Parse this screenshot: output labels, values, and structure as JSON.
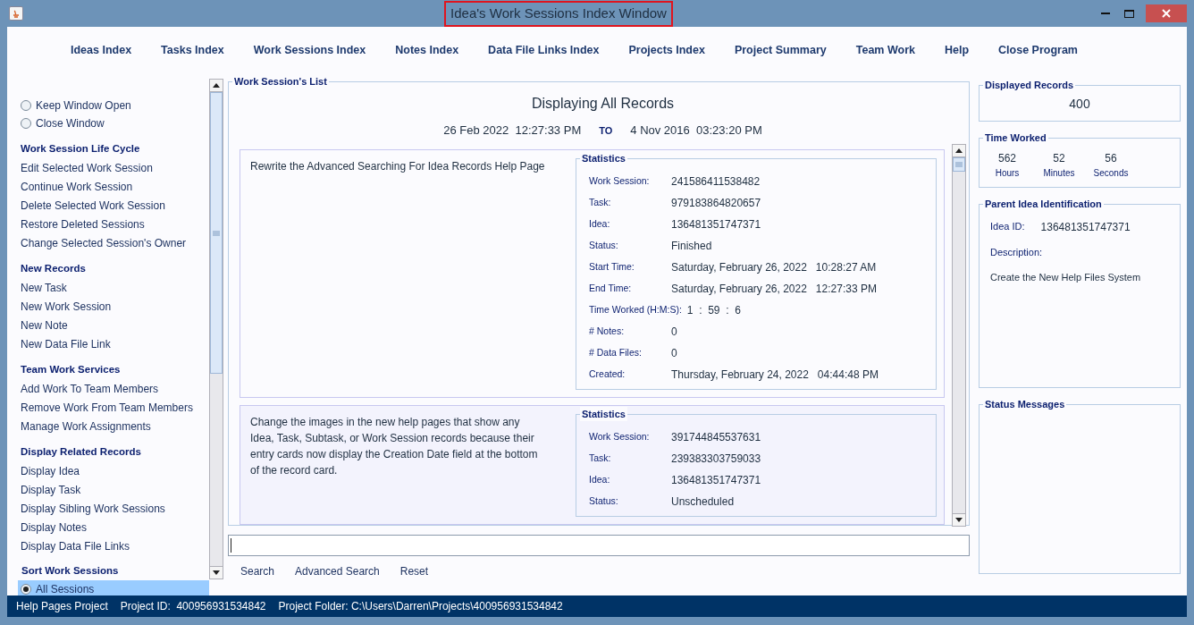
{
  "window": {
    "title": "Idea's Work Sessions Index Window",
    "title_highlighted": true
  },
  "menu": [
    "Ideas Index",
    "Tasks Index",
    "Work Sessions Index",
    "Notes Index",
    "Data File Links Index",
    "Projects Index",
    "Project Summary",
    "Team Work",
    "Help",
    "Close Program"
  ],
  "sidebar": {
    "options": [
      {
        "label": "Keep Window Open",
        "selected": false
      },
      {
        "label": "Close Window",
        "selected": false
      }
    ],
    "sections": [
      {
        "title": "Work Session Life Cycle",
        "items": [
          "Edit Selected Work Session",
          "Continue Work Session",
          "Delete Selected Work Session",
          "Restore Deleted Sessions",
          "Change Selected Session's Owner"
        ]
      },
      {
        "title": "New Records",
        "items": [
          "New Task",
          "New Work Session",
          "New Note",
          "New Data File Link"
        ]
      },
      {
        "title": "Team Work Services",
        "items": [
          "Add Work To Team Members",
          "Remove Work From Team Members",
          "Manage Work Assignments"
        ]
      },
      {
        "title": "Display Related Records",
        "items": [
          "Display Idea",
          "Display Task",
          "Display Sibling Work Sessions",
          "Display Notes",
          "Display Data File Links"
        ]
      }
    ],
    "sort": {
      "title": "Sort Work Sessions",
      "options": [
        {
          "label": "All Sessions",
          "selected": true
        }
      ]
    }
  },
  "list": {
    "title": "Work Session's List",
    "heading": "Displaying All Records",
    "range_from": "26 Feb 2022  12:27:33 PM",
    "range_sep": "TO",
    "range_to": "4 Nov 2016  03:23:20 PM",
    "records": [
      {
        "description": "Rewrite the Advanced Searching For Idea Records Help Page",
        "stats_title": "Statistics",
        "fields": [
          {
            "label": "Work Session:",
            "value": "241586411538482"
          },
          {
            "label": "Task:",
            "value": "979183864820657"
          },
          {
            "label": "Idea:",
            "value": "136481351747371"
          },
          {
            "label": "Status:",
            "value": "Finished"
          },
          {
            "label": "Start Time:",
            "value": "Saturday, February 26, 2022   10:28:27 AM"
          },
          {
            "label": "End Time:",
            "value": "Saturday, February 26, 2022   12:27:33 PM"
          },
          {
            "label": "Time Worked (H:M:S):",
            "value": "1  :  59  :  6"
          },
          {
            "label": "# Notes:",
            "value": "0"
          },
          {
            "label": "# Data Files:",
            "value": "0"
          },
          {
            "label": "Created:",
            "value": "Thursday, February 24, 2022   04:44:48 PM"
          }
        ]
      },
      {
        "description": "Change the images in the new help pages that show any Idea, Task, Subtask, or Work Session records because their entry cards now display the Creation Date field at the bottom of the record card.",
        "stats_title": "Statistics",
        "fields": [
          {
            "label": "Work Session:",
            "value": "391744845537631"
          },
          {
            "label": "Task:",
            "value": "239383303759033"
          },
          {
            "label": "Idea:",
            "value": "136481351747371"
          },
          {
            "label": "Status:",
            "value": "Unscheduled"
          }
        ]
      }
    ]
  },
  "search": {
    "buttons": [
      "Search",
      "Advanced Search",
      "Reset"
    ]
  },
  "right": {
    "displayed": {
      "title": "Displayed Records",
      "value": "400"
    },
    "time_worked": {
      "title": "Time Worked",
      "parts": [
        {
          "value": "562",
          "unit": "Hours"
        },
        {
          "value": "52",
          "unit": "Minutes"
        },
        {
          "value": "56",
          "unit": "Seconds"
        }
      ]
    },
    "parent": {
      "title": "Parent Idea Identification",
      "id_label": "Idea ID:",
      "id_value": "136481351747371",
      "desc_label": "Description:",
      "description": "Create the New Help Files System"
    },
    "status": {
      "title": "Status Messages"
    }
  },
  "status_bar": [
    "Help Pages Project",
    "Project ID:  400956931534842",
    "Project Folder: C:\\Users\\Darren\\Projects\\400956931534842"
  ]
}
